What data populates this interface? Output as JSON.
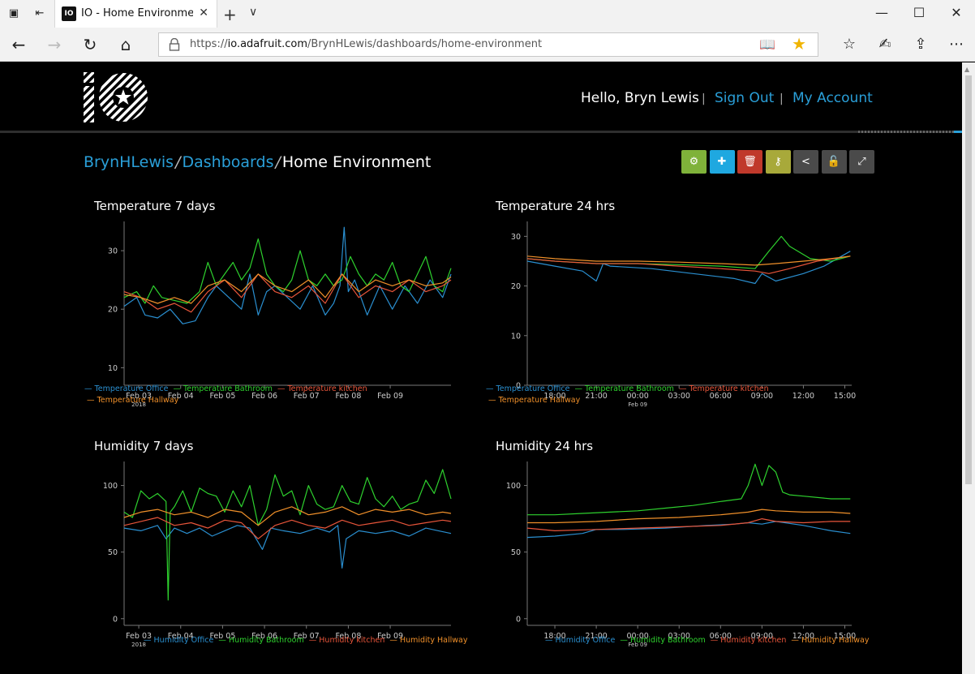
{
  "browser": {
    "tab_title": "IO - Home Environment",
    "url_prefix": "https://",
    "url_host": "io.adafruit.com",
    "url_path": "/BrynHLewis/dashboards/home-environment"
  },
  "header": {
    "logo_text": "IO",
    "greeting": "Hello, Bryn Lewis",
    "separator": "|",
    "sign_out": "Sign Out",
    "my_account": "My Account"
  },
  "breadcrumb": {
    "user": "BrynHLewis",
    "section": "Dashboards",
    "current": "Home Environment",
    "separator": "/"
  },
  "actions": [
    {
      "name": "settings-button",
      "icon": "gear-icon",
      "glyph": "⚙",
      "color": "#7fb23a"
    },
    {
      "name": "add-block-button",
      "icon": "plus-icon",
      "glyph": "✚",
      "color": "#1fa8e0"
    },
    {
      "name": "delete-button",
      "icon": "trash-icon",
      "glyph": "🗑",
      "color": "#c0392b"
    },
    {
      "name": "key-button",
      "icon": "key-icon",
      "glyph": "⚷",
      "color": "#a8a93a"
    },
    {
      "name": "share-button",
      "icon": "share-icon",
      "glyph": "<",
      "color": "#4a4a4a"
    },
    {
      "name": "lock-button",
      "icon": "unlock-icon",
      "glyph": "🔓",
      "color": "#4a4a4a"
    },
    {
      "name": "fullscreen-button",
      "icon": "expand-icon",
      "glyph": "⤢",
      "color": "#4a4a4a"
    }
  ],
  "colors": {
    "office": "#2a8fd0",
    "bathroom": "#2ed12e",
    "kitchen": "#e8553a",
    "hallway": "#f0902a",
    "link": "#2a9fd8"
  },
  "chart_data": [
    {
      "type": "line",
      "title": "Temperature 7 days",
      "x_ticks": [
        "Feb 03",
        "Feb 04",
        "Feb 05",
        "Feb 06",
        "Feb 07",
        "Feb 08",
        "Feb 09"
      ],
      "x_sub_label": "2018",
      "xlim": [
        0,
        7.8
      ],
      "y_ticks": [
        10,
        20,
        30
      ],
      "ylim": [
        7,
        35
      ],
      "series": [
        {
          "name": "Temperature Office",
          "color_key": "office",
          "x": [
            0,
            0.3,
            0.5,
            0.8,
            1.1,
            1.4,
            1.7,
            2.0,
            2.2,
            2.5,
            2.8,
            3.0,
            3.2,
            3.4,
            3.6,
            3.9,
            4.2,
            4.5,
            4.8,
            5.0,
            5.15,
            5.25,
            5.35,
            5.5,
            5.8,
            6.1,
            6.4,
            6.7,
            7.0,
            7.3,
            7.6,
            7.8
          ],
          "y": [
            20.5,
            22,
            19,
            18.5,
            20,
            17.5,
            18,
            22,
            24,
            22,
            20,
            26,
            19,
            23,
            24,
            22,
            20,
            24,
            19,
            21,
            24,
            34,
            23,
            25,
            19,
            24,
            20,
            24,
            21,
            25,
            22,
            26
          ]
        },
        {
          "name": "Temperature Bathroom",
          "color_key": "bathroom",
          "x": [
            0,
            0.3,
            0.5,
            0.7,
            0.9,
            1.2,
            1.5,
            1.8,
            2.0,
            2.2,
            2.4,
            2.6,
            2.8,
            3.0,
            3.2,
            3.4,
            3.6,
            3.8,
            4.0,
            4.2,
            4.4,
            4.6,
            4.8,
            5.0,
            5.2,
            5.4,
            5.6,
            5.8,
            6.0,
            6.2,
            6.4,
            6.6,
            6.8,
            7.0,
            7.2,
            7.4,
            7.6,
            7.8
          ],
          "y": [
            22,
            23,
            21,
            24,
            22,
            21.5,
            21,
            23,
            28,
            24,
            26,
            28,
            25,
            27,
            32,
            26,
            24,
            23,
            25,
            30,
            25,
            24,
            26,
            24,
            25,
            29,
            26,
            24,
            26,
            25,
            28,
            24,
            23,
            26,
            29,
            24,
            23,
            27
          ]
        },
        {
          "name": "Temperature kitchen",
          "color_key": "kitchen",
          "x": [
            0,
            0.4,
            0.8,
            1.2,
            1.6,
            2.0,
            2.4,
            2.8,
            3.2,
            3.6,
            4.0,
            4.4,
            4.8,
            5.2,
            5.6,
            6.0,
            6.4,
            6.8,
            7.2,
            7.6,
            7.8
          ],
          "y": [
            23,
            22,
            20,
            21,
            19.5,
            23,
            25,
            22,
            26,
            23,
            22,
            24,
            21,
            26,
            22,
            24,
            23,
            25,
            23,
            24,
            25
          ]
        },
        {
          "name": "Temperature Hallway",
          "color_key": "hallway",
          "x": [
            0,
            0.4,
            0.8,
            1.2,
            1.6,
            2.0,
            2.4,
            2.8,
            3.2,
            3.6,
            4.0,
            4.4,
            4.8,
            5.2,
            5.6,
            6.0,
            6.4,
            6.8,
            7.2,
            7.6,
            7.8
          ],
          "y": [
            22.5,
            22,
            21,
            22,
            21,
            24,
            25,
            23,
            26,
            24,
            23,
            25,
            22,
            26,
            23,
            25,
            24,
            25,
            24,
            24.5,
            25.5
          ]
        }
      ]
    },
    {
      "type": "line",
      "title": "Temperature 24 hrs",
      "x_ticks": [
        "18:00",
        "21:00",
        "00:00",
        "03:00",
        "06:00",
        "09:00",
        "12:00",
        "15:00"
      ],
      "x_sub_label": "Feb 09",
      "xlim": [
        16,
        39.5
      ],
      "y_ticks": [
        0,
        10,
        20,
        30
      ],
      "ylim": [
        0,
        33
      ],
      "series": [
        {
          "name": "Temperature Office",
          "color_key": "office",
          "x": [
            16,
            18,
            20,
            21,
            21.5,
            22,
            25,
            28,
            31,
            32.5,
            33,
            34,
            36,
            37.5,
            39.4
          ],
          "y": [
            25,
            24,
            23,
            21,
            24.5,
            24,
            23.5,
            22.5,
            21.5,
            20.5,
            22.5,
            21,
            22.5,
            24,
            27
          ]
        },
        {
          "name": "Temperature Bathroom",
          "color_key": "bathroom",
          "x": [
            16,
            18,
            21,
            24,
            27,
            30,
            32.5,
            33.5,
            34.4,
            35,
            36.5,
            38,
            39.4
          ],
          "y": [
            25.5,
            25,
            24.5,
            24.5,
            24.3,
            24,
            23.5,
            27,
            30,
            28,
            25.5,
            25,
            26
          ]
        },
        {
          "name": "Temperature kitchen",
          "color_key": "kitchen",
          "x": [
            16,
            18,
            21,
            24,
            27,
            30,
            32.5,
            33.5,
            35,
            37,
            39.4
          ],
          "y": [
            25.5,
            25,
            24.5,
            24.5,
            24,
            23.5,
            23,
            22.5,
            23.5,
            25,
            26
          ]
        },
        {
          "name": "Temperature Hallway",
          "color_key": "hallway",
          "x": [
            16,
            18,
            21,
            24,
            27,
            30,
            32.5,
            34,
            36,
            38,
            39.4
          ],
          "y": [
            26,
            25.5,
            25,
            25,
            24.8,
            24.5,
            24.2,
            24.5,
            25,
            25.5,
            26
          ]
        }
      ]
    },
    {
      "type": "line",
      "title": "Humidity 7 days",
      "x_ticks": [
        "Feb 03",
        "Feb 04",
        "Feb 05",
        "Feb 06",
        "Feb 07",
        "Feb 08",
        "Feb 09"
      ],
      "x_sub_label": "2018",
      "xlim": [
        0,
        7.8
      ],
      "y_ticks": [
        0,
        50,
        100
      ],
      "ylim": [
        -5,
        118
      ],
      "series": [
        {
          "name": "Humidity Office",
          "color_key": "office",
          "x": [
            0,
            0.4,
            0.8,
            1.0,
            1.2,
            1.5,
            1.8,
            2.1,
            2.4,
            2.7,
            3.0,
            3.3,
            3.5,
            3.8,
            4.2,
            4.6,
            4.9,
            5.1,
            5.2,
            5.3,
            5.6,
            6.0,
            6.4,
            6.8,
            7.2,
            7.5,
            7.8
          ],
          "y": [
            68,
            66,
            70,
            60,
            68,
            64,
            68,
            62,
            66,
            70,
            68,
            52,
            68,
            66,
            64,
            68,
            65,
            70,
            38,
            60,
            66,
            64,
            66,
            62,
            68,
            66,
            64
          ]
        },
        {
          "name": "Humidity Bathroom",
          "color_key": "bathroom",
          "x": [
            0,
            0.2,
            0.4,
            0.6,
            0.8,
            1.0,
            1.05,
            1.1,
            1.2,
            1.4,
            1.6,
            1.8,
            2.0,
            2.2,
            2.4,
            2.6,
            2.8,
            3.0,
            3.2,
            3.4,
            3.6,
            3.8,
            4.0,
            4.2,
            4.4,
            4.6,
            4.8,
            5.0,
            5.2,
            5.4,
            5.6,
            5.8,
            6.0,
            6.2,
            6.4,
            6.6,
            6.8,
            7.0,
            7.2,
            7.4,
            7.6,
            7.8
          ],
          "y": [
            80,
            76,
            96,
            90,
            94,
            88,
            14,
            80,
            84,
            96,
            80,
            98,
            94,
            92,
            80,
            96,
            84,
            100,
            70,
            82,
            108,
            92,
            96,
            78,
            100,
            86,
            82,
            84,
            100,
            88,
            86,
            106,
            90,
            84,
            92,
            82,
            86,
            88,
            104,
            94,
            112,
            90
          ]
        },
        {
          "name": "Humidity kitchen",
          "color_key": "kitchen",
          "x": [
            0,
            0.4,
            0.8,
            1.2,
            1.6,
            2.0,
            2.4,
            2.8,
            3.2,
            3.6,
            4.0,
            4.4,
            4.8,
            5.2,
            5.6,
            6.0,
            6.4,
            6.8,
            7.2,
            7.6,
            7.8
          ],
          "y": [
            70,
            73,
            76,
            70,
            72,
            68,
            74,
            72,
            60,
            70,
            74,
            70,
            68,
            74,
            70,
            72,
            74,
            70,
            72,
            74,
            73
          ]
        },
        {
          "name": "Humidity Hallway",
          "color_key": "hallway",
          "x": [
            0,
            0.4,
            0.8,
            1.2,
            1.6,
            2.0,
            2.4,
            2.8,
            3.2,
            3.6,
            4.0,
            4.4,
            4.8,
            5.2,
            5.6,
            6.0,
            6.4,
            6.8,
            7.2,
            7.6,
            7.8
          ],
          "y": [
            76,
            80,
            82,
            78,
            80,
            76,
            82,
            80,
            70,
            80,
            84,
            78,
            80,
            84,
            78,
            82,
            80,
            82,
            78,
            80,
            79
          ]
        }
      ]
    },
    {
      "type": "line",
      "title": "Humidity 24 hrs",
      "x_ticks": [
        "18:00",
        "21:00",
        "00:00",
        "03:00",
        "06:00",
        "09:00",
        "12:00",
        "15:00"
      ],
      "x_sub_label": "Feb 09",
      "xlim": [
        16,
        39.5
      ],
      "y_ticks": [
        0,
        50,
        100
      ],
      "ylim": [
        -5,
        118
      ],
      "series": [
        {
          "name": "Humidity Office",
          "color_key": "office",
          "x": [
            16,
            18,
            20,
            21,
            23,
            26,
            29,
            31,
            32,
            33,
            34,
            36,
            38,
            39.4
          ],
          "y": [
            61,
            62,
            64,
            67,
            67,
            68,
            70,
            71,
            72,
            71,
            73,
            70,
            66,
            64
          ]
        },
        {
          "name": "Humidity Bathroom",
          "color_key": "bathroom",
          "x": [
            16,
            18,
            20,
            22,
            24,
            26,
            28,
            30,
            31.5,
            32,
            32.5,
            33,
            33.5,
            34,
            34.5,
            35,
            36,
            38,
            39.4
          ],
          "y": [
            78,
            78,
            79,
            80,
            81,
            83,
            85,
            88,
            90,
            100,
            116,
            100,
            115,
            110,
            95,
            93,
            92,
            90,
            90
          ]
        },
        {
          "name": "Humidity kitchen",
          "color_key": "kitchen",
          "x": [
            16,
            18,
            21,
            24,
            27,
            30,
            32,
            33,
            34,
            36,
            38,
            39.4
          ],
          "y": [
            68,
            66,
            67,
            68,
            69,
            70,
            72,
            75,
            73,
            72,
            73,
            73
          ]
        },
        {
          "name": "Humidity Hallway",
          "color_key": "hallway",
          "x": [
            16,
            18,
            21,
            24,
            27,
            30,
            32,
            33,
            34,
            36,
            38,
            39.4
          ],
          "y": [
            72,
            72,
            73,
            75,
            76,
            78,
            80,
            82,
            81,
            80,
            80,
            79
          ]
        }
      ]
    }
  ]
}
